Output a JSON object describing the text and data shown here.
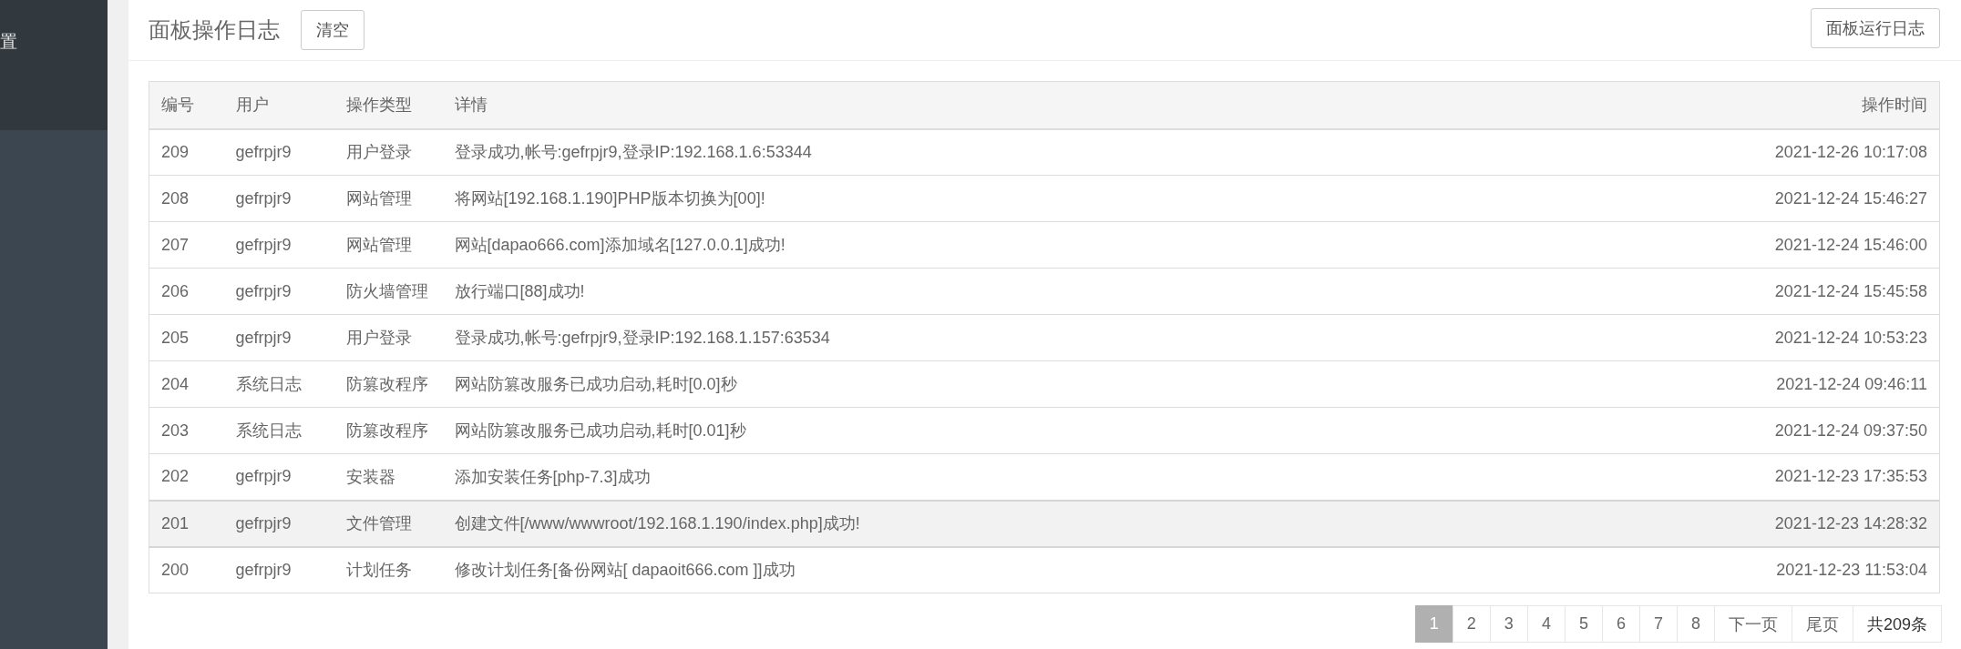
{
  "sidebar": {
    "items": [
      {
        "label": "置"
      }
    ]
  },
  "header": {
    "title": "面板操作日志",
    "buttons": [
      {
        "label": "清空"
      }
    ],
    "right_buttons": [
      {
        "label": "面板运行日志"
      }
    ]
  },
  "table": {
    "columns": [
      "编号",
      "用户",
      "操作类型",
      "详情",
      "操作时间"
    ],
    "rows": [
      {
        "cells": [
          "209",
          "gefrpjr9",
          "用户登录",
          "登录成功,帐号:gefrpjr9,登录IP:192.168.1.6:53344",
          "2021-12-26 10:17:08"
        ],
        "highlighted": false
      },
      {
        "cells": [
          "208",
          "gefrpjr9",
          "网站管理",
          "将网站[192.168.1.190]PHP版本切换为[00]!",
          "2021-12-24 15:46:27"
        ],
        "highlighted": false
      },
      {
        "cells": [
          "207",
          "gefrpjr9",
          "网站管理",
          "网站[dapao666.com]添加域名[127.0.0.1]成功!",
          "2021-12-24 15:46:00"
        ],
        "highlighted": false
      },
      {
        "cells": [
          "206",
          "gefrpjr9",
          "防火墙管理",
          "放行端口[88]成功!",
          "2021-12-24 15:45:58"
        ],
        "highlighted": false
      },
      {
        "cells": [
          "205",
          "gefrpjr9",
          "用户登录",
          "登录成功,帐号:gefrpjr9,登录IP:192.168.1.157:63534",
          "2021-12-24 10:53:23"
        ],
        "highlighted": false
      },
      {
        "cells": [
          "204",
          "系统日志",
          "防篡改程序",
          "网站防篡改服务已成功启动,耗时[0.0]秒",
          "2021-12-24 09:46:11"
        ],
        "highlighted": false
      },
      {
        "cells": [
          "203",
          "系统日志",
          "防篡改程序",
          "网站防篡改服务已成功启动,耗时[0.01]秒",
          "2021-12-24 09:37:50"
        ],
        "highlighted": false
      },
      {
        "cells": [
          "202",
          "gefrpjr9",
          "安装器",
          "添加安装任务[php-7.3]成功",
          "2021-12-23 17:35:53"
        ],
        "highlighted": false
      },
      {
        "cells": [
          "201",
          "gefrpjr9",
          "文件管理",
          "创建文件[/www/wwwroot/192.168.1.190/index.php]成功!",
          "2021-12-23 14:28:32"
        ],
        "highlighted": true
      },
      {
        "cells": [
          "200",
          "gefrpjr9",
          "计划任务",
          "修改计划任务[备份网站[ dapaoit666.com ]]成功",
          "2021-12-23 11:53:04"
        ],
        "highlighted": false
      }
    ]
  },
  "pagination": {
    "pages": [
      {
        "label": "1",
        "selected": true
      },
      {
        "label": "2",
        "selected": false
      },
      {
        "label": "3",
        "selected": false
      },
      {
        "label": "4",
        "selected": false
      },
      {
        "label": "5",
        "selected": false
      },
      {
        "label": "6",
        "selected": false
      },
      {
        "label": "7",
        "selected": false
      },
      {
        "label": "8",
        "selected": false
      }
    ],
    "links": [
      {
        "label": "下一页"
      },
      {
        "label": "尾页"
      }
    ],
    "total": "共209条"
  }
}
